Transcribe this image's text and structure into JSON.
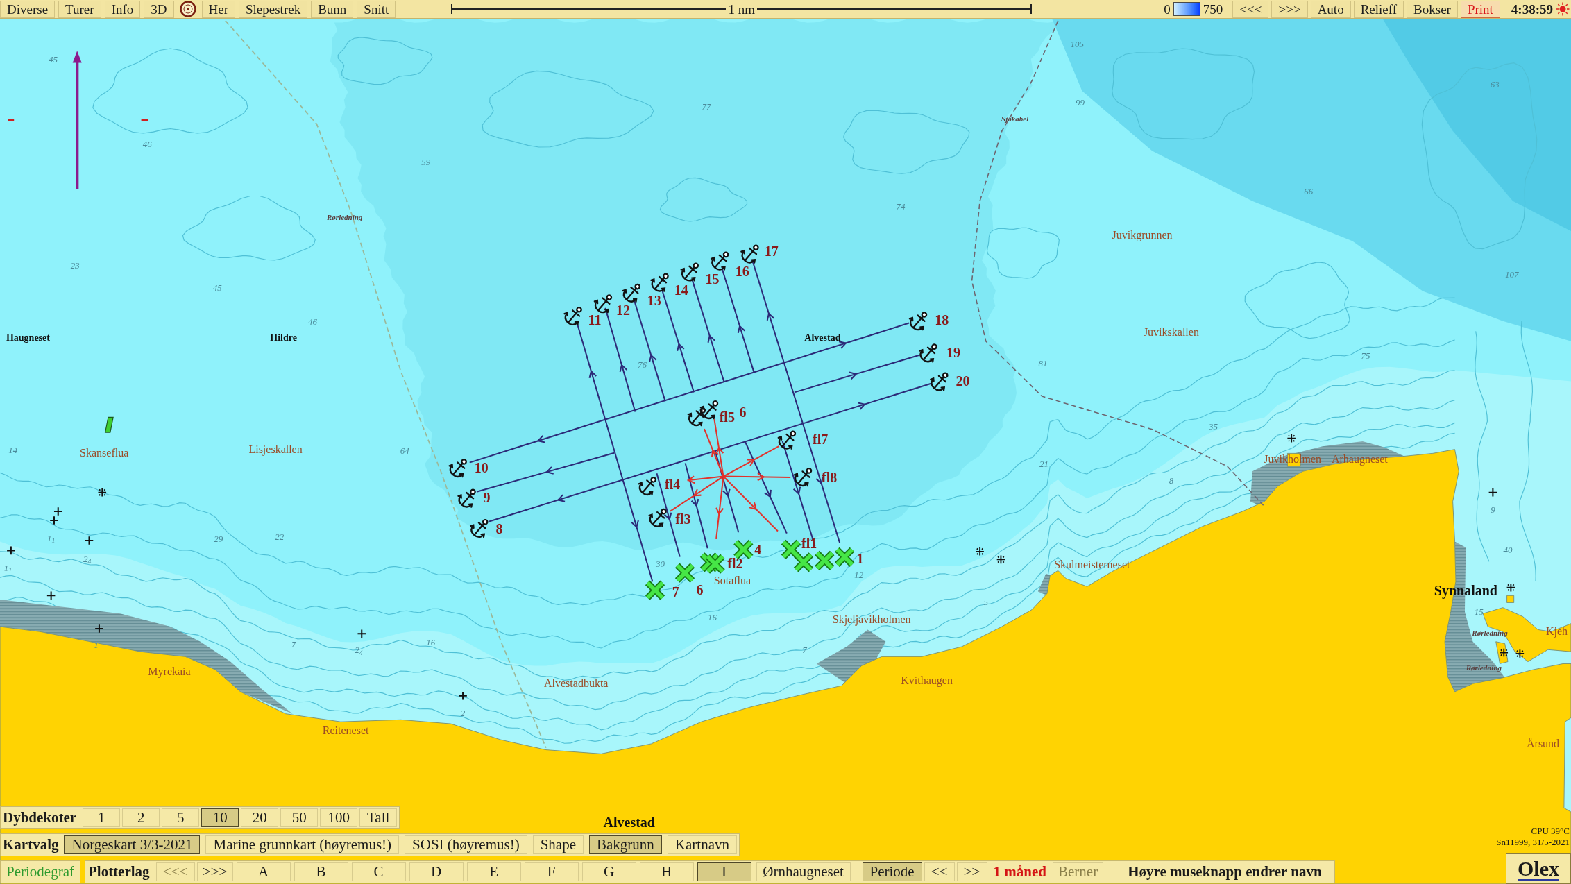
{
  "top_bar": {
    "menu": [
      {
        "label": "Diverse"
      },
      {
        "label": "Turer"
      },
      {
        "label": "Info"
      },
      {
        "label": "3D"
      }
    ],
    "menu_2": [
      {
        "label": "Her"
      },
      {
        "label": "Slepestrek"
      },
      {
        "label": "Bunn"
      },
      {
        "label": "Snitt"
      }
    ],
    "scale_bar": {
      "label": "1 nm"
    },
    "depth_scale": {
      "min": "0",
      "max": "750"
    },
    "buttons": [
      {
        "label": "<<<",
        "active": false
      },
      {
        "label": ">>>",
        "active": false
      },
      {
        "label": "Auto",
        "active": false
      },
      {
        "label": "Relieff",
        "active": false
      },
      {
        "label": "Bokser",
        "active": false
      },
      {
        "label": "Print",
        "active": true
      }
    ],
    "clock": "4:38:59"
  },
  "map": {
    "labels": [
      {
        "text": "105",
        "kind": "depth"
      },
      {
        "text": "45",
        "kind": "depth"
      },
      {
        "text": "63",
        "kind": "depth"
      },
      {
        "text": "77",
        "kind": "depth"
      },
      {
        "text": "99",
        "kind": "depth"
      },
      {
        "text": "Sjøkabel",
        "kind": "note"
      },
      {
        "text": "46",
        "kind": "depth"
      },
      {
        "text": "59",
        "kind": "depth"
      },
      {
        "text": "66",
        "kind": "depth"
      },
      {
        "text": "74",
        "kind": "depth"
      },
      {
        "text": "Rørledning",
        "kind": "note"
      },
      {
        "text": "Juvikgrunnen",
        "kind": "place"
      },
      {
        "text": "23",
        "kind": "depth"
      },
      {
        "text": "107",
        "kind": "depth"
      },
      {
        "text": "45",
        "kind": "depth"
      },
      {
        "text": "46",
        "kind": "depth"
      },
      {
        "text": "Juvikskallen",
        "kind": "place"
      },
      {
        "text": "Haugneset",
        "kind": "town"
      },
      {
        "text": "Hildre",
        "kind": "town"
      },
      {
        "text": "Alvestad",
        "kind": "town"
      },
      {
        "text": "75",
        "kind": "depth"
      },
      {
        "text": "76",
        "kind": "depth"
      },
      {
        "text": "81",
        "kind": "depth"
      },
      {
        "text": "35",
        "kind": "depth"
      },
      {
        "text": "14",
        "kind": "depth"
      },
      {
        "text": "Skanseflua",
        "kind": "place"
      },
      {
        "text": "Lisjeskallen",
        "kind": "place"
      },
      {
        "text": "64",
        "kind": "depth"
      },
      {
        "text": "21",
        "kind": "depth"
      },
      {
        "text": "Juvikholmen",
        "kind": "place"
      },
      {
        "text": "Arhaugneset",
        "kind": "place"
      },
      {
        "text": "8",
        "kind": "depth"
      },
      {
        "text": "9",
        "kind": "depth"
      },
      {
        "text": "1$_{1}$",
        "kind": "depth"
      },
      {
        "text": "29",
        "kind": "depth"
      },
      {
        "text": "22",
        "kind": "depth"
      },
      {
        "text": "40",
        "kind": "depth"
      },
      {
        "text": "2$_{4}$",
        "kind": "depth"
      },
      {
        "text": "30",
        "kind": "depth"
      },
      {
        "text": "1$_{1}$",
        "kind": "depth"
      },
      {
        "text": "Skulmeisterneset",
        "kind": "place"
      },
      {
        "text": "12",
        "kind": "depth"
      },
      {
        "text": "Sotaflua",
        "kind": "place"
      },
      {
        "text": "Synnaland",
        "kind": "major"
      },
      {
        "text": "5",
        "kind": "depth"
      },
      {
        "text": "15",
        "kind": "depth"
      },
      {
        "text": "16",
        "kind": "depth"
      },
      {
        "text": "Skjeljavikholmen",
        "kind": "place"
      },
      {
        "text": "Rørledning",
        "kind": "note"
      },
      {
        "text": "Kjeh",
        "kind": "place"
      },
      {
        "text": "1",
        "kind": "depth"
      },
      {
        "text": "7",
        "kind": "depth"
      },
      {
        "text": "16",
        "kind": "depth"
      },
      {
        "text": "2$_{4}$",
        "kind": "depth"
      },
      {
        "text": "7",
        "kind": "depth"
      },
      {
        "text": "Rørledning",
        "kind": "note"
      },
      {
        "text": "Myrekaia",
        "kind": "place"
      },
      {
        "text": "Alvestadbukta",
        "kind": "place"
      },
      {
        "text": "Kvithaugen",
        "kind": "place"
      },
      {
        "text": "2",
        "kind": "depth"
      },
      {
        "text": "Reiteneset",
        "kind": "place"
      },
      {
        "text": "Årsund",
        "kind": "place"
      },
      {
        "text": "Alvestad",
        "kind": "major"
      }
    ],
    "waypoints": [
      {
        "label": "11"
      },
      {
        "label": "12"
      },
      {
        "label": "13"
      },
      {
        "label": "14"
      },
      {
        "label": "15"
      },
      {
        "label": "16"
      },
      {
        "label": "17"
      },
      {
        "label": "18"
      },
      {
        "label": "19"
      },
      {
        "label": "20"
      },
      {
        "label": "10"
      },
      {
        "label": "9"
      },
      {
        "label": "8"
      },
      {
        "label": "fl5"
      },
      {
        "label": "6"
      },
      {
        "label": "fl7"
      },
      {
        "label": "fl8"
      },
      {
        "label": "fl4"
      },
      {
        "label": "fl3"
      }
    ],
    "drops": [
      {
        "label": "7"
      },
      {
        "label": "6"
      },
      {
        "label": "fl2"
      },
      {
        "label": "4"
      },
      {
        "label": "fl1"
      },
      {
        "label": "1"
      }
    ]
  },
  "depth_contours": {
    "title": "Dybdekoter",
    "options": [
      {
        "label": "1",
        "selected": false
      },
      {
        "label": "2",
        "selected": false
      },
      {
        "label": "5",
        "selected": false
      },
      {
        "label": "10",
        "selected": true
      },
      {
        "label": "20",
        "selected": false
      },
      {
        "label": "50",
        "selected": false
      },
      {
        "label": "100",
        "selected": false
      },
      {
        "label": "Tall",
        "selected": false
      }
    ]
  },
  "chart_select": {
    "title": "Kartvalg",
    "options": [
      {
        "label": "Norgeskart 3/3-2021",
        "selected": true
      },
      {
        "label": "Marine grunnkart (høyremus!)",
        "selected": false
      },
      {
        "label": "SOSI (høyremus!)",
        "selected": false
      },
      {
        "label": "Shape",
        "selected": false
      },
      {
        "label": "Bakgrunn",
        "selected": true
      },
      {
        "label": "Kartnavn",
        "selected": false
      }
    ]
  },
  "plotter": {
    "graph_button": "Periodegraf",
    "title": "Plotterlag",
    "prev": {
      "label": "<<<",
      "disabled": true
    },
    "next": {
      "label": ">>>",
      "disabled": false
    },
    "layers": [
      {
        "label": "A",
        "selected": false
      },
      {
        "label": "B",
        "selected": false
      },
      {
        "label": "C",
        "selected": false
      },
      {
        "label": "D",
        "selected": false
      },
      {
        "label": "E",
        "selected": false
      },
      {
        "label": "F",
        "selected": false
      },
      {
        "label": "G",
        "selected": false
      },
      {
        "label": "H",
        "selected": false
      },
      {
        "label": "I",
        "selected": true
      }
    ],
    "layer_name": "Ørnhaugneset",
    "period": {
      "label": "Periode",
      "selected": true
    },
    "period_prev": "<<",
    "period_next": ">>",
    "period_value": "1 måned",
    "berner": {
      "label": "Berner",
      "disabled": true
    },
    "hint": "Høyre museknapp endrer navn"
  },
  "status": {
    "cpu": "CPU 39°C",
    "serial": "Sn11999, 31/5-2021"
  },
  "logo": "Olex"
}
